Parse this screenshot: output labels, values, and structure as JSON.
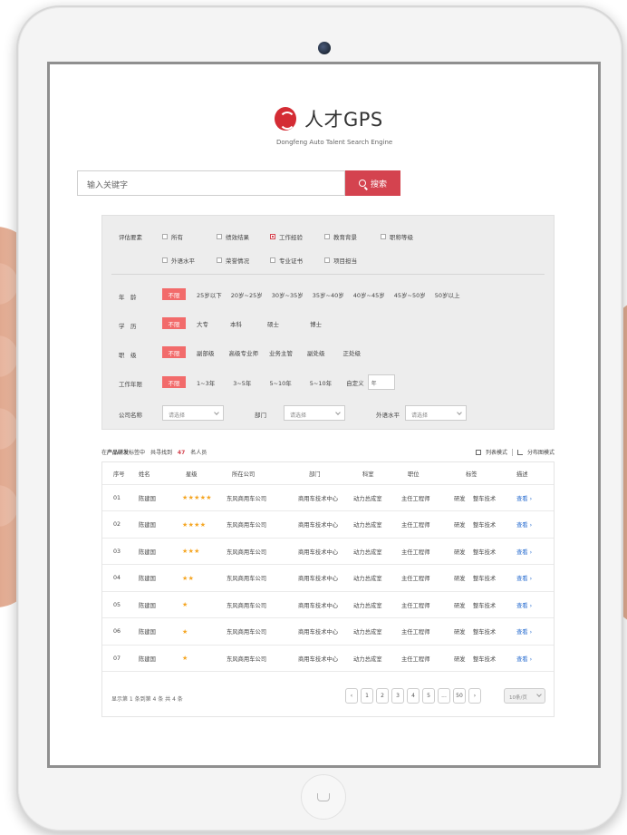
{
  "logo": {
    "title": "人才GPS",
    "subtitle": "Dongfeng Auto Talent Search Engine"
  },
  "search": {
    "placeholder": "输入关键字",
    "button_label": "搜索"
  },
  "filter": {
    "criteria_label": "评估要素",
    "criteria": [
      {
        "label": "所有",
        "checked": false
      },
      {
        "label": "绩效结果",
        "checked": false
      },
      {
        "label": "工作经验",
        "checked": true
      },
      {
        "label": "教育背景",
        "checked": false
      },
      {
        "label": "职称等级",
        "checked": false
      },
      {
        "label": "外语水平",
        "checked": false
      },
      {
        "label": "荣誉情况",
        "checked": false
      },
      {
        "label": "专业证书",
        "checked": false
      },
      {
        "label": "项目担当",
        "checked": false
      }
    ],
    "age": {
      "label": "年　龄",
      "options": [
        "不限",
        "25岁以下",
        "20岁~25岁",
        "30岁~35岁",
        "35岁~40岁",
        "40岁~45岁",
        "45岁~50岁",
        "50岁以上"
      ]
    },
    "education": {
      "label": "学　历",
      "options": [
        "不限",
        "大专",
        "本科",
        "硕士",
        "博士"
      ]
    },
    "rank": {
      "label": "职　级",
      "options": [
        "不限",
        "副部级",
        "高级专业师",
        "业务主管",
        "副处级",
        "正处级"
      ]
    },
    "years": {
      "label": "工作年限",
      "options": [
        "不限",
        "1~3年",
        "3~5年",
        "5~10年",
        "5~10年"
      ],
      "custom_label": "自定义",
      "custom_unit": "年"
    },
    "company": {
      "label": "公司名称",
      "placeholder": "请选择"
    },
    "department": {
      "label": "部门",
      "placeholder": "请选择"
    },
    "language": {
      "label": "外语水平",
      "placeholder": "请选择"
    }
  },
  "results": {
    "prefix": "在",
    "tag": "产品研发",
    "middle": "标签中",
    "found_label": "共寻找到",
    "count": "47",
    "suffix": "名人员",
    "list_mode": "列表模式",
    "distribution_mode": "分布图模式"
  },
  "table": {
    "headers": [
      "序号",
      "姓名",
      "星级",
      "所在公司",
      "部门",
      "科室",
      "职位",
      "标签",
      "描述"
    ],
    "rows": [
      {
        "no": "01",
        "name": "陈建国",
        "stars": "★★★★★",
        "company": "东风商用车公司",
        "dept": "商用车技术中心",
        "section": "动力总成室",
        "position": "主任工程师",
        "tag1": "研发",
        "tag2": "整车技术",
        "action": "查看 ›"
      },
      {
        "no": "02",
        "name": "陈建国",
        "stars": "★★★★",
        "company": "东风商用车公司",
        "dept": "商用车技术中心",
        "section": "动力总成室",
        "position": "主任工程师",
        "tag1": "研发",
        "tag2": "整车技术",
        "action": "查看 ›"
      },
      {
        "no": "03",
        "name": "陈建国",
        "stars": "★★★",
        "company": "东风商用车公司",
        "dept": "商用车技术中心",
        "section": "动力总成室",
        "position": "主任工程师",
        "tag1": "研发",
        "tag2": "整车技术",
        "action": "查看 ›"
      },
      {
        "no": "04",
        "name": "陈建国",
        "stars": "★★",
        "company": "东风商用车公司",
        "dept": "商用车技术中心",
        "section": "动力总成室",
        "position": "主任工程师",
        "tag1": "研发",
        "tag2": "整车技术",
        "action": "查看 ›"
      },
      {
        "no": "05",
        "name": "陈建国",
        "stars": "★",
        "company": "东风商用车公司",
        "dept": "商用车技术中心",
        "section": "动力总成室",
        "position": "主任工程师",
        "tag1": "研发",
        "tag2": "整车技术",
        "action": "查看 ›"
      },
      {
        "no": "06",
        "name": "陈建国",
        "stars": "★",
        "company": "东风商用车公司",
        "dept": "商用车技术中心",
        "section": "动力总成室",
        "position": "主任工程师",
        "tag1": "研发",
        "tag2": "整车技术",
        "action": "查看 ›"
      },
      {
        "no": "07",
        "name": "陈建国",
        "stars": "★",
        "company": "东风商用车公司",
        "dept": "商用车技术中心",
        "section": "动力总成室",
        "position": "主任工程师",
        "tag1": "研发",
        "tag2": "整车技术",
        "action": "查看 ›"
      }
    ]
  },
  "pagination": {
    "info": "显示第 1 条到第 4 条 共 4 条",
    "prev": "‹",
    "pages": [
      "1",
      "2",
      "3",
      "4",
      "5",
      "...",
      "50"
    ],
    "next": "›",
    "per_page": "10条/页"
  },
  "colors": {
    "accent": "#d4434f",
    "active_tag": "#f26b6b",
    "star": "#f5a623",
    "link": "#2c6fd1"
  }
}
